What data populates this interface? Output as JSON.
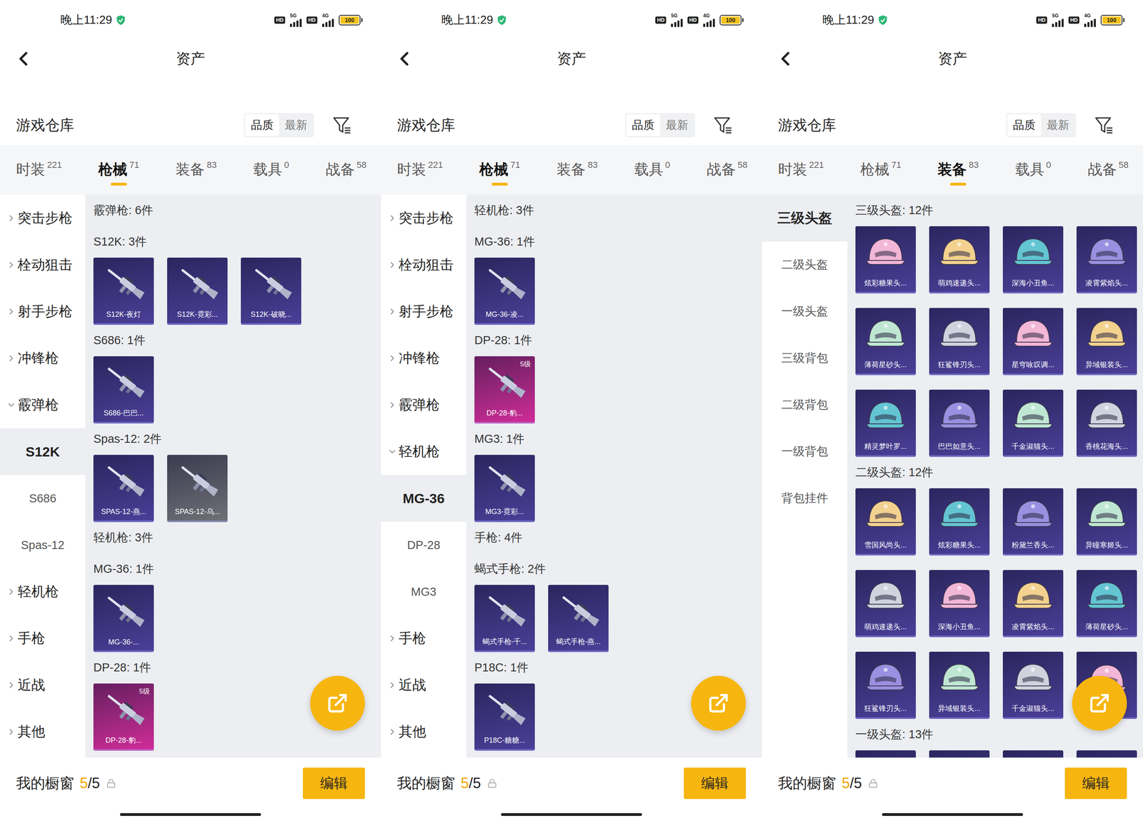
{
  "screens": [
    {
      "status_bar": {
        "time": "晚上11:29",
        "networks": [
          {
            "badge": "HD",
            "type": "5G",
            "level": 1
          },
          {
            "badge": "HD",
            "type": "4G",
            "level": 1
          }
        ],
        "battery": {
          "text": "100",
          "level": 1
        }
      },
      "header": {
        "title": "资产"
      },
      "section": {
        "title": "游戏仓库",
        "sort": [
          {
            "label": "品质",
            "selected": true
          },
          {
            "label": "最新",
            "selected": false
          }
        ]
      },
      "tabs": [
        {
          "label": "时装",
          "count": "221",
          "selected": false
        },
        {
          "label": "枪械",
          "count": "71",
          "selected": true
        },
        {
          "label": "装备",
          "count": "83",
          "selected": false
        },
        {
          "label": "载具",
          "count": "0",
          "selected": false
        },
        {
          "label": "战备",
          "count": "58",
          "selected": false
        }
      ],
      "sidebar": [
        {
          "label": "突击步枪",
          "kind": "group",
          "expanded": false,
          "selected": false
        },
        {
          "label": "栓动狙击",
          "kind": "group",
          "expanded": false,
          "selected": false
        },
        {
          "label": "射手步枪",
          "kind": "group",
          "expanded": false,
          "selected": false
        },
        {
          "label": "冲锋枪",
          "kind": "group",
          "expanded": false,
          "selected": false
        },
        {
          "label": "霰弹枪",
          "kind": "group",
          "expanded": true,
          "selected": false
        },
        {
          "label": "S12K",
          "kind": "sub",
          "expanded": false,
          "selected": true
        },
        {
          "label": "S686",
          "kind": "sub",
          "expanded": false,
          "selected": false
        },
        {
          "label": "Spas-12",
          "kind": "sub",
          "expanded": false,
          "selected": false
        },
        {
          "label": "轻机枪",
          "kind": "group",
          "expanded": false,
          "selected": false
        },
        {
          "label": "手枪",
          "kind": "group",
          "expanded": false,
          "selected": false
        },
        {
          "label": "近战",
          "kind": "group",
          "expanded": false,
          "selected": false
        },
        {
          "label": "其他",
          "kind": "group",
          "expanded": false,
          "selected": false
        }
      ],
      "groups": [
        {
          "label": "霰弹枪: 6件",
          "items": []
        },
        {
          "label": "S12K: 3件",
          "items": [
            {
              "label": "S12K-夜灯",
              "kind": "gun",
              "color": "#4b3f98"
            },
            {
              "label": "S12K-霓彩...",
              "kind": "gun",
              "color": "#4b3f98"
            },
            {
              "label": "S12K-破晓...",
              "kind": "gun",
              "color": "#4b3f98"
            }
          ]
        },
        {
          "label": "S686: 1件",
          "items": [
            {
              "label": "S686-巴巴...",
              "kind": "gun",
              "color": "#4b3f98"
            }
          ]
        },
        {
          "label": "Spas-12: 2件",
          "items": [
            {
              "label": "SPAS-12-燕...",
              "kind": "gun",
              "color": "#4b3f98"
            },
            {
              "label": "SPAS-12-乌...",
              "kind": "gun",
              "color": "#6f7076"
            }
          ]
        },
        {
          "label": "轻机枪: 3件",
          "items": []
        },
        {
          "label": "MG-36: 1件",
          "items": [
            {
              "label": "MG-36-...",
              "kind": "gun",
              "color": "#4b3f98"
            }
          ]
        },
        {
          "label": "DP-28: 1件",
          "items": [
            {
              "label": "DP-28-豹...",
              "kind": "gun",
              "color": "#d02c98",
              "badge": "5级"
            }
          ]
        }
      ],
      "bottom_bar": {
        "label": "我的橱窗",
        "used": "5",
        "total": "/5",
        "button": "编辑"
      }
    },
    {
      "status_bar": {
        "time": "晚上11:29",
        "networks": [
          {
            "badge": "HD",
            "type": "5G",
            "level": 1
          },
          {
            "badge": "HD",
            "type": "4G",
            "level": 1
          }
        ],
        "battery": {
          "text": "100",
          "level": 1
        }
      },
      "header": {
        "title": "资产"
      },
      "section": {
        "title": "游戏仓库",
        "sort": [
          {
            "label": "品质",
            "selected": true
          },
          {
            "label": "最新",
            "selected": false
          }
        ]
      },
      "tabs": [
        {
          "label": "时装",
          "count": "221",
          "selected": false
        },
        {
          "label": "枪械",
          "count": "71",
          "selected": true
        },
        {
          "label": "装备",
          "count": "83",
          "selected": false
        },
        {
          "label": "载具",
          "count": "0",
          "selected": false
        },
        {
          "label": "战备",
          "count": "58",
          "selected": false
        }
      ],
      "sidebar": [
        {
          "label": "突击步枪",
          "kind": "group",
          "expanded": false,
          "selected": false
        },
        {
          "label": "栓动狙击",
          "kind": "group",
          "expanded": false,
          "selected": false
        },
        {
          "label": "射手步枪",
          "kind": "group",
          "expanded": false,
          "selected": false
        },
        {
          "label": "冲锋枪",
          "kind": "group",
          "expanded": false,
          "selected": false
        },
        {
          "label": "霰弹枪",
          "kind": "group",
          "expanded": false,
          "selected": false
        },
        {
          "label": "轻机枪",
          "kind": "group",
          "expanded": true,
          "selected": false
        },
        {
          "label": "MG-36",
          "kind": "sub",
          "expanded": false,
          "selected": true
        },
        {
          "label": "DP-28",
          "kind": "sub",
          "expanded": false,
          "selected": false
        },
        {
          "label": "MG3",
          "kind": "sub",
          "expanded": false,
          "selected": false
        },
        {
          "label": "手枪",
          "kind": "group",
          "expanded": false,
          "selected": false
        },
        {
          "label": "近战",
          "kind": "group",
          "expanded": false,
          "selected": false
        },
        {
          "label": "其他",
          "kind": "group",
          "expanded": false,
          "selected": false
        }
      ],
      "groups": [
        {
          "label": "轻机枪: 3件",
          "items": []
        },
        {
          "label": "MG-36: 1件",
          "items": [
            {
              "label": "MG-36-凌...",
              "kind": "gun",
              "color": "#4b3f98"
            }
          ]
        },
        {
          "label": "DP-28: 1件",
          "items": [
            {
              "label": "DP-28-豹...",
              "kind": "gun",
              "color": "#d02c98",
              "badge": "5级"
            }
          ]
        },
        {
          "label": "MG3: 1件",
          "items": [
            {
              "label": "MG3-霓彩...",
              "kind": "gun",
              "color": "#4b3f98"
            }
          ]
        },
        {
          "label": "手枪: 4件",
          "items": []
        },
        {
          "label": "蝎式手枪: 2件",
          "items": [
            {
              "label": "蝎式手枪-千...",
              "kind": "gun",
              "color": "#4b3f98"
            },
            {
              "label": "蝎式手枪-燕...",
              "kind": "gun",
              "color": "#4b3f98"
            }
          ]
        },
        {
          "label": "P18C: 1件",
          "items": [
            {
              "label": "P18C-糖糖...",
              "kind": "gun",
              "color": "#4b3f98"
            }
          ]
        }
      ],
      "bottom_bar": {
        "label": "我的橱窗",
        "used": "5",
        "total": "/5",
        "button": "编辑"
      }
    },
    {
      "status_bar": {
        "time": "晚上11:29",
        "networks": [
          {
            "badge": "HD",
            "type": "5G",
            "level": 1
          },
          {
            "badge": "HD",
            "type": "4G",
            "level": 1
          }
        ],
        "battery": {
          "text": "100",
          "level": 1
        }
      },
      "header": {
        "title": "资产"
      },
      "section": {
        "title": "游戏仓库",
        "sort": [
          {
            "label": "品质",
            "selected": true
          },
          {
            "label": "最新",
            "selected": false
          }
        ]
      },
      "tabs": [
        {
          "label": "时装",
          "count": "221",
          "selected": false
        },
        {
          "label": "枪械",
          "count": "71",
          "selected": false
        },
        {
          "label": "装备",
          "count": "83",
          "selected": true
        },
        {
          "label": "载具",
          "count": "0",
          "selected": false
        },
        {
          "label": "战备",
          "count": "58",
          "selected": false
        }
      ],
      "sidebar": [
        {
          "label": "三级头盔",
          "kind": "sub",
          "expanded": false,
          "selected": true
        },
        {
          "label": "二级头盔",
          "kind": "sub",
          "expanded": false,
          "selected": false
        },
        {
          "label": "一级头盔",
          "kind": "sub",
          "expanded": false,
          "selected": false
        },
        {
          "label": "三级背包",
          "kind": "sub",
          "expanded": false,
          "selected": false
        },
        {
          "label": "二级背包",
          "kind": "sub",
          "expanded": false,
          "selected": false
        },
        {
          "label": "一级背包",
          "kind": "sub",
          "expanded": false,
          "selected": false
        },
        {
          "label": "背包挂件",
          "kind": "sub",
          "expanded": false,
          "selected": false
        }
      ],
      "groups": [
        {
          "label": "三级头盔: 12件",
          "items": [
            {
              "label": "炫彩糖果头...",
              "kind": "helmet",
              "color": "#4b3f98"
            },
            {
              "label": "萌鸡速递头...",
              "kind": "helmet",
              "color": "#4b3f98"
            },
            {
              "label": "深海小丑鱼...",
              "kind": "helmet",
              "color": "#4b3f98"
            },
            {
              "label": "凌霄紫焰头...",
              "kind": "helmet",
              "color": "#4b3f98"
            },
            {
              "label": "薄荷星砂头...",
              "kind": "helmet",
              "color": "#4b3f98"
            },
            {
              "label": "狂鲨锋刃头...",
              "kind": "helmet",
              "color": "#4b3f98"
            },
            {
              "label": "星穹咏叹调...",
              "kind": "helmet",
              "color": "#4b3f98"
            },
            {
              "label": "异域银装头...",
              "kind": "helmet",
              "color": "#4b3f98"
            },
            {
              "label": "精灵梦叶罗...",
              "kind": "helmet",
              "color": "#4b3f98"
            },
            {
              "label": "巴巴如意头...",
              "kind": "helmet",
              "color": "#4b3f98"
            },
            {
              "label": "千金淑猫头...",
              "kind": "helmet",
              "color": "#4b3f98"
            },
            {
              "label": "香桃花海头...",
              "kind": "helmet",
              "color": "#4b3f98"
            }
          ]
        },
        {
          "label": "二级头盔: 12件",
          "items": [
            {
              "label": "雪国风尚头...",
              "kind": "helmet",
              "color": "#4b3f98"
            },
            {
              "label": "炫彩糖果头...",
              "kind": "helmet",
              "color": "#4b3f98"
            },
            {
              "label": "粉黛兰香头...",
              "kind": "helmet",
              "color": "#4b3f98"
            },
            {
              "label": "异瞳寒姬头...",
              "kind": "helmet",
              "color": "#4b3f98"
            },
            {
              "label": "萌鸡速递头...",
              "kind": "helmet",
              "color": "#4b3f98"
            },
            {
              "label": "深海小丑鱼...",
              "kind": "helmet",
              "color": "#4b3f98"
            },
            {
              "label": "凌霄紫焰头...",
              "kind": "helmet",
              "color": "#4b3f98"
            },
            {
              "label": "薄荷星砂头...",
              "kind": "helmet",
              "color": "#4b3f98"
            },
            {
              "label": "狂鲨锋刃头...",
              "kind": "helmet",
              "color": "#4b3f98"
            },
            {
              "label": "异域银装头...",
              "kind": "helmet",
              "color": "#4b3f98"
            },
            {
              "label": "千金淑猫头...",
              "kind": "helmet",
              "color": "#4b3f98"
            },
            {
              "label": "",
              "kind": "helmet",
              "color": "#4b3f98"
            }
          ]
        },
        {
          "label": "一级头盔: 13件",
          "items": [
            {
              "label": "",
              "kind": "helmet",
              "color": "#4b3f98"
            },
            {
              "label": "",
              "kind": "helmet",
              "color": "#4b3f98"
            },
            {
              "label": "",
              "kind": "helmet",
              "color": "#4b3f98"
            },
            {
              "label": "",
              "kind": "helmet",
              "color": "#4b3f98"
            }
          ]
        }
      ],
      "bottom_bar": {
        "label": "我的橱窗",
        "used": "5",
        "total": "/5",
        "button": "编辑"
      }
    }
  ]
}
